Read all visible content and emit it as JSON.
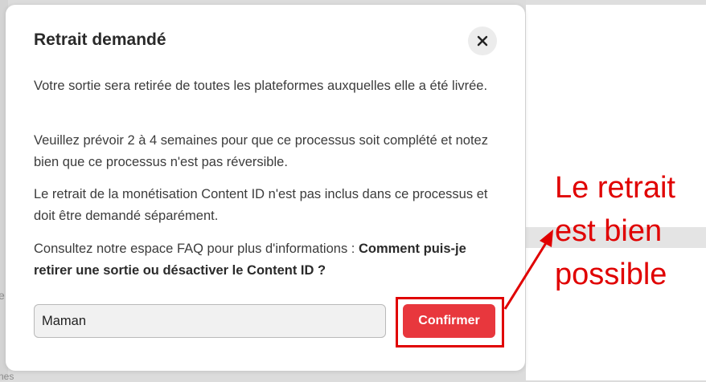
{
  "dialog": {
    "title": "Retrait demandé",
    "paragraphs": [
      "Votre sortie sera retirée de toutes les plateformes auxquelles elle a été livrée.",
      "Veuillez prévoir 2 à 4 semaines pour que ce processus soit complété et notez bien que ce processus n'est pas réversible.",
      "Le retrait de la monétisation Content ID n'est pas inclus dans ce processus et doit être demandé séparément."
    ],
    "faq_text": "Consultez notre espace FAQ pour plus d'informations : ",
    "faq_link": "Comment puis-je retirer une sortie ou désactiver le Content ID ?",
    "input_value": "Maman",
    "confirm_label": "Confirmer",
    "close_icon": "close-icon"
  },
  "annotation": {
    "lines": [
      "Le retrait",
      "est bien",
      "possible"
    ],
    "color": "#e00000"
  },
  "background": {
    "fragment_1": "e",
    "fragment_2": "nes"
  },
  "colors": {
    "accent": "#e8373d",
    "annotation": "#e00000",
    "text": "#3c3c3c",
    "title": "#2a2a2a"
  }
}
